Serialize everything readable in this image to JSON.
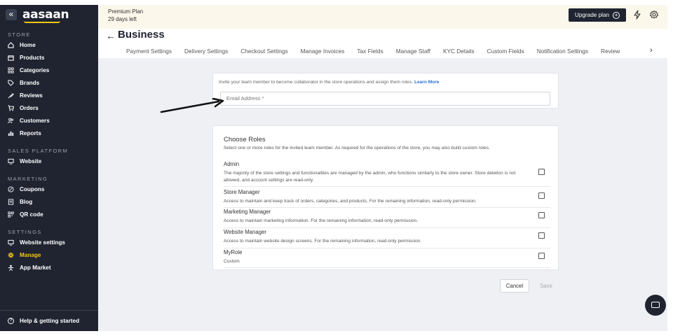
{
  "sidebar": {
    "logo": "aasaan",
    "collapse_icon": "«",
    "sections": [
      {
        "title": "STORE",
        "items": [
          "Home",
          "Products",
          "Categories",
          "Brands",
          "Reviews",
          "Orders",
          "Customers",
          "Reports"
        ]
      },
      {
        "title": "SALES PLATFORM",
        "items": [
          "Website"
        ]
      },
      {
        "title": "MARKETING",
        "items": [
          "Coupons",
          "Blog",
          "QR code"
        ]
      },
      {
        "title": "SETTINGS",
        "items": [
          "Website settings",
          "Manage",
          "App Market"
        ]
      }
    ],
    "active_item": "Manage",
    "help": "Help & getting started"
  },
  "header": {
    "plan_name": "Premium Plan",
    "plan_days": "29 days left",
    "upgrade_label": "Upgrade plan",
    "upgrade_icon": "plus-circle-icon",
    "bolt_icon": "bolt-icon",
    "settings_icon": "gear-icon"
  },
  "page": {
    "back_icon": "←",
    "title": "Business",
    "tabs": [
      "Payment Settings",
      "Delivery Settings",
      "Checkout Settings",
      "Manage Invoices",
      "Tax Fields",
      "Manage Staff",
      "KYC Details",
      "Custom Fields",
      "Notification Settings",
      "Review"
    ],
    "tabs_next_icon": "›"
  },
  "invite": {
    "text": "Invite your team member to become collaborator in the store operations and assign them roles.",
    "learn_more": "Learn More",
    "email_placeholder": "Email Address *"
  },
  "roles": {
    "title": "Choose Roles",
    "subtitle": "Select one or more roles for the invited team member. As required for the operations of the store, you may also build custom roles.",
    "items": [
      {
        "name": "Admin",
        "desc": "The majority of the store settings and functionalities are managed by the admin, who functions similarly to the store owner. Store deletion is not allowed, and account settings are read-only.",
        "checked": false
      },
      {
        "name": "Store Manager",
        "desc": "Access to maintain and keep track of orders, categories, and products. For the remaining information, read-only permission.",
        "checked": false
      },
      {
        "name": "Marketing Manager",
        "desc": "Access to maintain marketing information. For the remaining information, read-only permission.",
        "checked": false
      },
      {
        "name": "Website Manager",
        "desc": "Access to maintain website design screens. For the remaining information, read-only permission.",
        "checked": false
      },
      {
        "name": "MyRole",
        "desc": "Custom",
        "checked": false
      }
    ]
  },
  "actions": {
    "cancel": "Cancel",
    "save": "Save"
  },
  "colors": {
    "sidebar_bg": "#1f2430",
    "accent": "#f5c518",
    "link": "#2a6fd6",
    "header_bg": "#fbf7ea",
    "content_bg": "#eef0f4"
  }
}
